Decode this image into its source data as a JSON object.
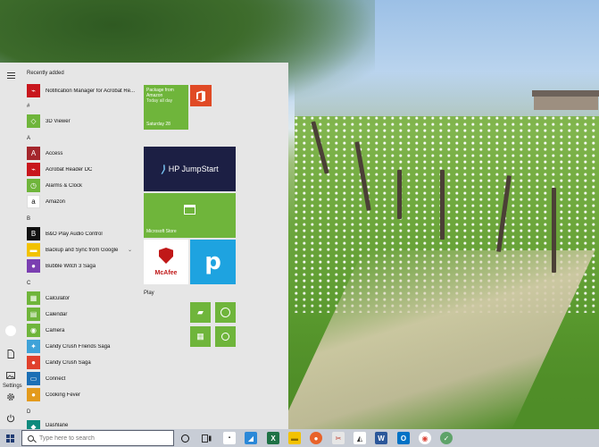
{
  "start_menu": {
    "hamburger_icon": "hamburger-icon",
    "settings_label": "Settings",
    "sections": {
      "recently_added": "Recently added",
      "hash": "#",
      "a": "A",
      "b": "B",
      "c": "C",
      "d": "D"
    },
    "apps": {
      "notification_manager": "Notification Manager for Acrobat Re...",
      "viewer_3d": "3D Viewer",
      "access": "Access",
      "acrobat": "Acrobat Reader DC",
      "alarms": "Alarms & Clock",
      "amazon": "Amazon",
      "bo_play": "B&O Play Audio Control",
      "backup_sync": "Backup and Sync from Google",
      "bubble_witch": "Bubble Witch 3 Saga",
      "calculator": "Calculator",
      "calendar": "Calendar",
      "camera": "Camera",
      "candy_friends": "Candy Crush Friends Saga",
      "candy_saga": "Candy Crush Saga",
      "connect": "Connect",
      "cooking_fever": "Cooking Fever",
      "dashlane": "Dashlane"
    },
    "tiles": {
      "calendar_line1": "Package from",
      "calendar_line2": "Amazon",
      "calendar_line3": "Today all day",
      "calendar_date": "Saturday 28",
      "hp_jumpstart": "HP JumpStart",
      "microsoft_store": "Microsoft Store",
      "mcafee": "McAfee",
      "pandora": "p",
      "play_group": "Play"
    }
  },
  "taskbar": {
    "search_placeholder": "Type here to search"
  },
  "colors": {
    "accent_green": "#6fb53b",
    "office_red": "#e04a25",
    "hp_navy": "#1c1f44",
    "pandora_blue": "#1ea3e0",
    "mcafee_red": "#c01818"
  }
}
